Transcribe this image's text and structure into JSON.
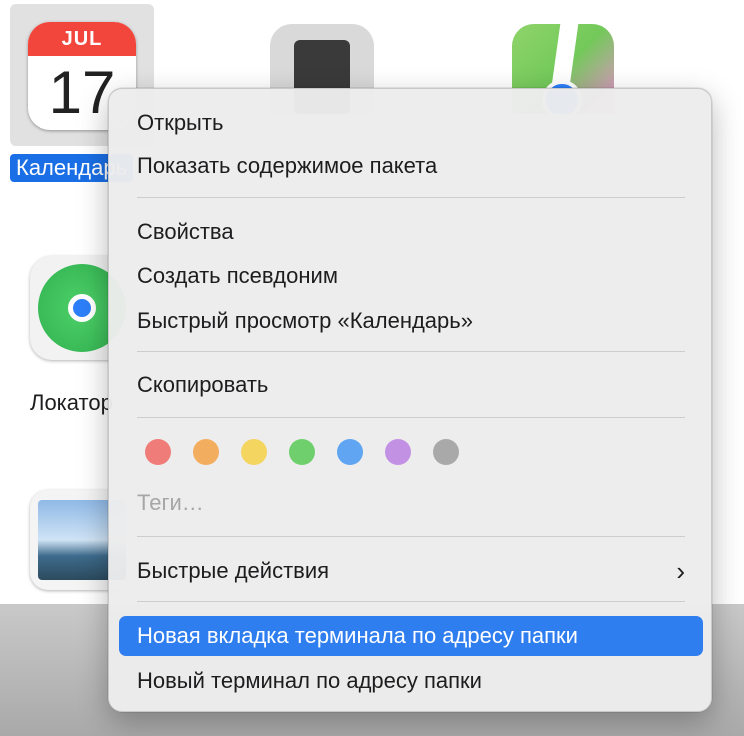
{
  "apps": {
    "calendar": {
      "label": "Календарь",
      "month": "JUL",
      "day": "17"
    },
    "findmy": {
      "label": "Локатор"
    }
  },
  "context_menu": {
    "items": [
      {
        "label": "Открыть"
      },
      {
        "label": "Показать содержимое пакета"
      },
      {
        "label": "Свойства"
      },
      {
        "label": "Создать псевдоним"
      },
      {
        "label": "Быстрый просмотр «Календарь»"
      },
      {
        "label": "Скопировать"
      },
      {
        "label": "Теги…",
        "disabled": true
      },
      {
        "label": "Быстрые действия",
        "submenu_arrow": "›"
      },
      {
        "label": "Новая вкладка терминала по адресу папки",
        "highlighted": true
      },
      {
        "label": "Новый терминал по адресу папки"
      }
    ],
    "tags": [
      {
        "name": "red",
        "color": "#ef7c78"
      },
      {
        "name": "orange",
        "color": "#f3ad5e"
      },
      {
        "name": "yellow",
        "color": "#f4d55f"
      },
      {
        "name": "green",
        "color": "#6fcf6c"
      },
      {
        "name": "blue",
        "color": "#5fa5f2"
      },
      {
        "name": "purple",
        "color": "#c291e3"
      },
      {
        "name": "gray",
        "color": "#a9a9a9"
      }
    ]
  },
  "colors": {
    "highlight": "#2f7ef0",
    "selection": "#1a6fe6"
  }
}
